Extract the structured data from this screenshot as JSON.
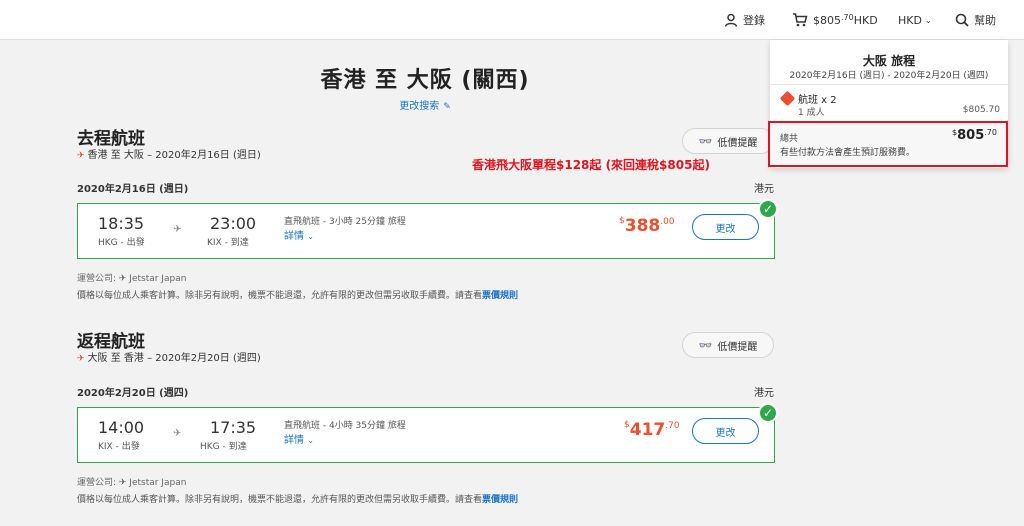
{
  "header": {
    "login_label": "登錄",
    "cart_amount_main": "805",
    "cart_amount_cents": ".70",
    "cart_currency": "HKD",
    "cart_symbol": "$",
    "currency_selector": "HKD",
    "help_label": "幫助"
  },
  "page": {
    "title": "香港 至 大阪 (關西)",
    "modify_search": "更改搜索"
  },
  "annotation": "香港飛大阪單程$128起 (來回連稅$805起)",
  "outbound": {
    "section_title": "去程航班",
    "route_summary": "香港 至 大阪 – 2020年2月16日 (週日)",
    "fare_alert": "低價提醒",
    "date": "2020年2月16日 (週日)",
    "currency": "港元",
    "depart_time": "18:35",
    "depart_place": "HKG - 出發",
    "arrive_time": "23:00",
    "arrive_place": "KIX - 到達",
    "flight_info": "直飛航班 - 3小時 25分鐘 旅程",
    "details": "詳情",
    "price_symbol": "$",
    "price_main": "388",
    "price_cents": ".00",
    "change": "更改",
    "operator": "運營公司: ✈ Jetstar Japan",
    "rules_text": "價格以每位成人乘客計算。除非另有說明，機票不能退還，允許有限的更改但需另收取手續費。請查看",
    "rules_link": "票價規則"
  },
  "inbound": {
    "section_title": "返程航班",
    "route_summary": "大阪 至 香港 – 2020年2月20日 (週四)",
    "fare_alert": "低價提醒",
    "date": "2020年2月20日 (週四)",
    "currency": "港元",
    "depart_time": "14:00",
    "depart_place": "KIX - 出發",
    "arrive_time": "17:35",
    "arrive_place": "HKG - 到達",
    "flight_info": "直飛航班 - 4小時 35分鐘 旅程",
    "details": "詳情",
    "price_symbol": "$",
    "price_main": "417",
    "price_cents": ".70",
    "change": "更改",
    "operator": "運營公司: ✈ Jetstar Japan",
    "rules_text": "價格以每位成人乘客計算。除非另有說明，機票不能退還，允許有限的更改但需另收取手續費。請查看",
    "rules_link": "票價規則"
  },
  "cart_panel": {
    "title": "大阪 旅程",
    "dates": "2020年2月16日 (週日) - 2020年2月20日 (週四)",
    "flights_label": "航班 x 2",
    "adults_label": "1 成人",
    "line_amount": "$805.70",
    "total_label": "總共",
    "total_symbol": "$",
    "total_main": "805",
    "total_cents": ".70",
    "total_note": "有些付款方法會產生預訂服務費。"
  },
  "colors": {
    "accent": "#1a73c9",
    "price": "#e8502f",
    "selected_border": "#2ea84a",
    "annotation": "#e0141e"
  }
}
